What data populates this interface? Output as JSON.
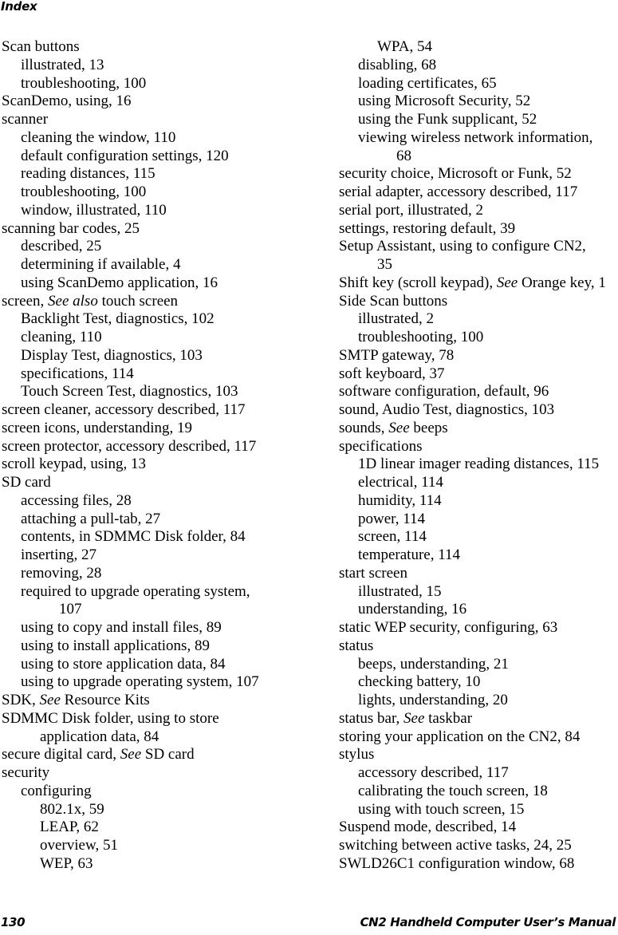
{
  "header": {
    "section": "Index"
  },
  "footer": {
    "page_number": "130",
    "manual_title": "CN2 Handheld Computer User’s Manual"
  },
  "columns": [
    {
      "entries": [
        {
          "level": 0,
          "text": "Scan buttons"
        },
        {
          "level": 1,
          "text": "illustrated, 13"
        },
        {
          "level": 1,
          "text": "troubleshooting, 100"
        },
        {
          "level": 0,
          "text": "ScanDemo, using, 16"
        },
        {
          "level": 0,
          "text": "scanner"
        },
        {
          "level": 1,
          "text": "cleaning the window, 110"
        },
        {
          "level": 1,
          "text": "default configuration settings, 120"
        },
        {
          "level": 1,
          "text": "reading distances, 115"
        },
        {
          "level": 1,
          "text": "troubleshooting, 100"
        },
        {
          "level": 1,
          "text": "window, illustrated, 110"
        },
        {
          "level": 0,
          "text": "scanning bar codes, 25"
        },
        {
          "level": 1,
          "text": "described, 25"
        },
        {
          "level": 1,
          "text": "determining if available, 4"
        },
        {
          "level": 1,
          "text": "using ScanDemo application, 16"
        },
        {
          "level": 0,
          "text": "screen, ",
          "see": "See also",
          "after": " touch screen"
        },
        {
          "level": 1,
          "text": "Backlight Test, diagnostics, 102"
        },
        {
          "level": 1,
          "text": "cleaning, 110"
        },
        {
          "level": 1,
          "text": "Display Test, diagnostics, 103"
        },
        {
          "level": 1,
          "text": "specifications, 114"
        },
        {
          "level": 1,
          "text": "Touch Screen Test, diagnostics, 103"
        },
        {
          "level": 0,
          "text": "screen cleaner, accessory described, 117"
        },
        {
          "level": 0,
          "text": "screen icons, understanding, 19"
        },
        {
          "level": 0,
          "text": "screen protector, accessory described, 117"
        },
        {
          "level": 0,
          "text": "scroll keypad, using, 13"
        },
        {
          "level": 0,
          "text": "SD card"
        },
        {
          "level": 1,
          "text": "accessing files, 28"
        },
        {
          "level": 1,
          "text": "attaching a pull-tab, 27"
        },
        {
          "level": 1,
          "text": "contents, in SDMMC Disk folder, 84"
        },
        {
          "level": 1,
          "text": "inserting, 27"
        },
        {
          "level": 1,
          "text": "removing, 28"
        },
        {
          "level": 1,
          "text": "required to upgrade operating system,",
          "continuation": "107"
        },
        {
          "level": 1,
          "text": "using to copy and install files, 89"
        },
        {
          "level": 1,
          "text": "using to install applications, 89"
        },
        {
          "level": 1,
          "text": "using to store application data, 84"
        },
        {
          "level": 1,
          "text": "using to upgrade operating system, 107"
        },
        {
          "level": 0,
          "text": "SDK, ",
          "see": "See",
          "after": " Resource Kits"
        },
        {
          "level": 0,
          "text": "SDMMC Disk folder, using to store",
          "continuation": "application data, 84"
        },
        {
          "level": 0,
          "text": "secure digital card, ",
          "see": "See",
          "after": " SD card"
        },
        {
          "level": 0,
          "text": "security"
        },
        {
          "level": 1,
          "text": "configuring"
        },
        {
          "level": 2,
          "text": "802.1x, 59"
        },
        {
          "level": 2,
          "text": "LEAP, 62"
        },
        {
          "level": 2,
          "text": "overview, 51"
        },
        {
          "level": 2,
          "text": "WEP, 63"
        }
      ]
    },
    {
      "entries": [
        {
          "level": 2,
          "text": "WPA, 54"
        },
        {
          "level": 1,
          "text": "disabling, 68"
        },
        {
          "level": 1,
          "text": "loading certificates, 65"
        },
        {
          "level": 1,
          "text": "using Microsoft Security, 52"
        },
        {
          "level": 1,
          "text": "using the Funk supplicant, 52"
        },
        {
          "level": 1,
          "text": "viewing wireless network information,",
          "continuation": "68"
        },
        {
          "level": 0,
          "text": "security choice, Microsoft or Funk, 52"
        },
        {
          "level": 0,
          "text": "serial adapter, accessory described, 117"
        },
        {
          "level": 0,
          "text": "serial port, illustrated, 2"
        },
        {
          "level": 0,
          "text": "settings, restoring default, 39"
        },
        {
          "level": 0,
          "text": "Setup Assistant, using to configure CN2,",
          "continuation": "35"
        },
        {
          "level": 0,
          "text": "Shift key (scroll keypad), ",
          "see": "See",
          "after": " Orange key, 1"
        },
        {
          "level": 0,
          "text": "Side Scan buttons"
        },
        {
          "level": 1,
          "text": "illustrated, 2"
        },
        {
          "level": 1,
          "text": "troubleshooting, 100"
        },
        {
          "level": 0,
          "text": "SMTP gateway, 78"
        },
        {
          "level": 0,
          "text": "soft keyboard, 37"
        },
        {
          "level": 0,
          "text": "software configuration, default, 96"
        },
        {
          "level": 0,
          "text": "sound, Audio Test, diagnostics, 103"
        },
        {
          "level": 0,
          "text": "sounds, ",
          "see": "See",
          "after": " beeps"
        },
        {
          "level": 0,
          "text": "specifications"
        },
        {
          "level": 1,
          "text": "1D linear imager reading distances, 115"
        },
        {
          "level": 1,
          "text": "electrical, 114"
        },
        {
          "level": 1,
          "text": "humidity, 114"
        },
        {
          "level": 1,
          "text": "power, 114"
        },
        {
          "level": 1,
          "text": "screen, 114"
        },
        {
          "level": 1,
          "text": "temperature, 114"
        },
        {
          "level": 0,
          "text": "start screen"
        },
        {
          "level": 1,
          "text": "illustrated, 15"
        },
        {
          "level": 1,
          "text": "understanding, 16"
        },
        {
          "level": 0,
          "text": "static WEP security, configuring, 63"
        },
        {
          "level": 0,
          "text": "status"
        },
        {
          "level": 1,
          "text": "beeps, understanding, 21"
        },
        {
          "level": 1,
          "text": "checking battery, 10"
        },
        {
          "level": 1,
          "text": "lights, understanding, 20"
        },
        {
          "level": 0,
          "text": "status bar, ",
          "see": "See",
          "after": " taskbar"
        },
        {
          "level": 0,
          "text": "storing your application on the CN2, 84"
        },
        {
          "level": 0,
          "text": "stylus"
        },
        {
          "level": 1,
          "text": "accessory described, 117"
        },
        {
          "level": 1,
          "text": "calibrating the touch screen, 18"
        },
        {
          "level": 1,
          "text": "using with touch screen, 15"
        },
        {
          "level": 0,
          "text": "Suspend mode, described, 14"
        },
        {
          "level": 0,
          "text": "switching between active tasks, 24, 25"
        },
        {
          "level": 0,
          "text": "SWLD26C1 configuration window, 68"
        }
      ]
    }
  ]
}
